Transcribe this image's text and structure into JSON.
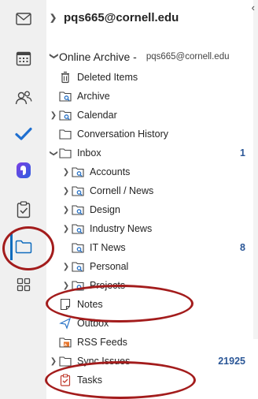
{
  "rail": {
    "items": [
      {
        "name": "mail",
        "icon": "mail-icon"
      },
      {
        "name": "calendar",
        "icon": "calendar-icon"
      },
      {
        "name": "people",
        "icon": "people-icon"
      },
      {
        "name": "todo",
        "icon": "todo-check-icon"
      },
      {
        "name": "loop",
        "icon": "loop-icon"
      },
      {
        "name": "tasks",
        "icon": "clipboard-check-icon"
      },
      {
        "name": "folders",
        "icon": "folder-icon",
        "active": true
      },
      {
        "name": "apps",
        "icon": "apps-grid-icon"
      }
    ]
  },
  "pane": {
    "collapse_glyph": "‹",
    "account_label": "pqs665@cornell.edu",
    "archive": {
      "name": "Online Archive -",
      "email": "pqs665@cornell.edu"
    },
    "folders": [
      {
        "label": "Deleted Items",
        "icon": "trash-icon",
        "expandable": false,
        "indent": 0,
        "count": ""
      },
      {
        "label": "Archive",
        "icon": "search-folder-icon",
        "expandable": false,
        "indent": 0,
        "count": ""
      },
      {
        "label": "Calendar",
        "icon": "search-folder-icon",
        "expandable": true,
        "indent": 0,
        "count": ""
      },
      {
        "label": "Conversation History",
        "icon": "folder-icon",
        "expandable": false,
        "indent": 0,
        "count": ""
      },
      {
        "label": "Inbox",
        "icon": "folder-icon",
        "expandable": true,
        "open": true,
        "indent": 0,
        "count": "1"
      },
      {
        "label": "Accounts",
        "icon": "search-folder-icon",
        "expandable": true,
        "indent": 1,
        "count": ""
      },
      {
        "label": "Cornell / News",
        "icon": "search-folder-icon",
        "expandable": true,
        "indent": 1,
        "count": ""
      },
      {
        "label": "Design",
        "icon": "search-folder-icon",
        "expandable": true,
        "indent": 1,
        "count": ""
      },
      {
        "label": "Industry News",
        "icon": "search-folder-icon",
        "expandable": true,
        "indent": 1,
        "count": ""
      },
      {
        "label": "IT News",
        "icon": "search-folder-icon",
        "expandable": false,
        "indent": 1,
        "count": "8"
      },
      {
        "label": "Personal",
        "icon": "search-folder-icon",
        "expandable": true,
        "indent": 1,
        "count": ""
      },
      {
        "label": "Projects",
        "icon": "search-folder-icon",
        "expandable": true,
        "indent": 1,
        "count": ""
      },
      {
        "label": "Notes",
        "icon": "note-icon",
        "expandable": false,
        "indent": 0,
        "count": ""
      },
      {
        "label": "Outbox",
        "icon": "outbox-icon",
        "expandable": false,
        "indent": 0,
        "count": ""
      },
      {
        "label": "RSS Feeds",
        "icon": "rss-icon",
        "expandable": false,
        "indent": 0,
        "count": ""
      },
      {
        "label": "Sync Issues",
        "icon": "folder-icon",
        "expandable": true,
        "indent": 0,
        "count": "21925"
      },
      {
        "label": "Tasks",
        "icon": "task-clipboard-icon",
        "expandable": false,
        "indent": 0,
        "count": ""
      }
    ]
  },
  "colors": {
    "accent": "#0f6cbd",
    "annotation": "#a31c1c",
    "count": "#2b5797",
    "todo": "#1f6fd0"
  }
}
